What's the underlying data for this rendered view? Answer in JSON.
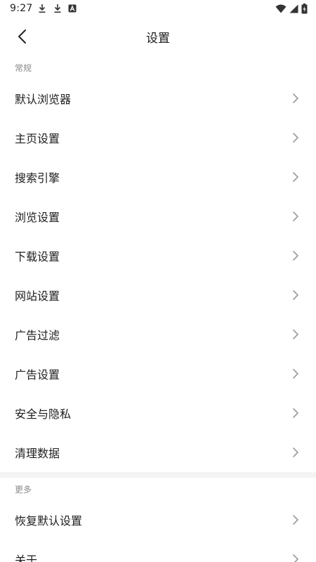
{
  "status_bar": {
    "time": "9:27",
    "left_icons": [
      "download-icon",
      "download-icon",
      "a-badge-icon"
    ],
    "right_icons": [
      "wifi-icon",
      "signal-icon",
      "battery-charging-icon"
    ]
  },
  "header": {
    "title": "设置",
    "back_icon": "chevron-left-icon"
  },
  "sections": {
    "general": {
      "title": "常规",
      "items": [
        {
          "label": "默认浏览器"
        },
        {
          "label": "主页设置"
        },
        {
          "label": "搜索引擎"
        },
        {
          "label": "浏览设置"
        },
        {
          "label": "下载设置"
        },
        {
          "label": "网站设置"
        },
        {
          "label": "广告过滤"
        },
        {
          "label": "广告设置"
        },
        {
          "label": "安全与隐私"
        },
        {
          "label": "清理数据"
        }
      ]
    },
    "more": {
      "title": "更多",
      "items": [
        {
          "label": "恢复默认设置"
        },
        {
          "label": "关于"
        }
      ]
    }
  },
  "colors": {
    "background": "#ffffff",
    "divider": "#f4f4f4",
    "section_header": "#8a8a8a",
    "chevron": "#9a9a9a"
  }
}
